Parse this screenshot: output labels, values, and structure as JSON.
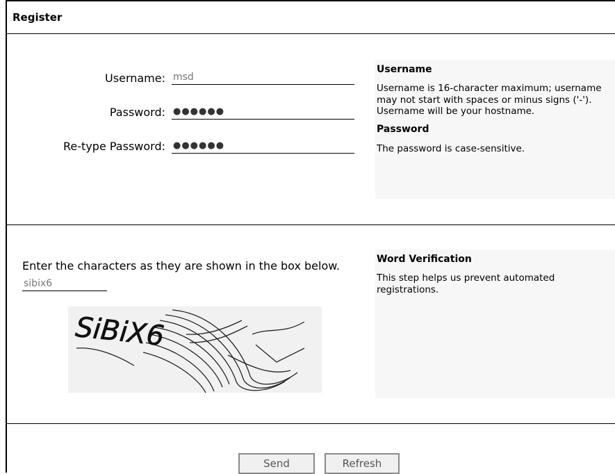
{
  "form": {
    "title": "Register"
  },
  "fields": {
    "username": {
      "label": "Username:",
      "value": "msd"
    },
    "password": {
      "label": "Password:",
      "value": "●●●●●●"
    },
    "retype": {
      "label": "Re-type Password:",
      "value": "●●●●●●"
    }
  },
  "help_account": {
    "username_heading": "Username",
    "username_text": "Username is 16-character maximum; username may not start with spaces or minus signs ('-'). Username will be your hostname.",
    "password_heading": "Password",
    "password_text": "The password is case-sensitive."
  },
  "verification": {
    "instruction": "Enter the characters as they are shown in the box below.",
    "value": "sibix6",
    "captcha_text": "SiBiX6",
    "help_heading": "Word Verification",
    "help_text": "This step helps us prevent automated registrations."
  },
  "buttons": {
    "send": "Send",
    "refresh": "Refresh"
  }
}
